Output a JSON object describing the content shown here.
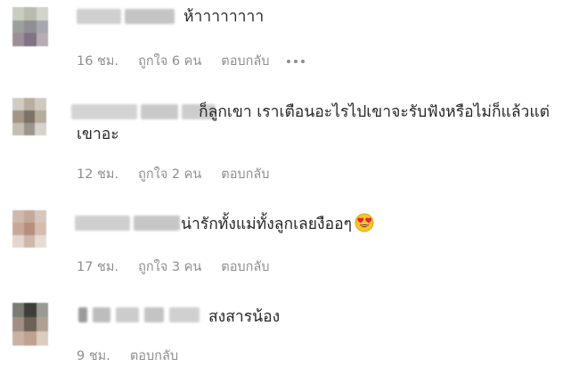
{
  "comments": [
    {
      "text_lines": [
        "ห้าาาาาาาา"
      ],
      "time": "16 ชม.",
      "likes": "ถูกใจ 6 คน",
      "reply": "ตอบกลับ",
      "has_more": true
    },
    {
      "text_lines": [
        "ก็ลูกเขา เราเตือนอะไรไปเขาจะรับฟังหรือไม่ก็แล้วแต่",
        "เขาอะ"
      ],
      "time": "12 ชม.",
      "likes": "ถูกใจ 2 คน",
      "reply": "ตอบกลับ",
      "has_more": false
    },
    {
      "text_lines": [
        "น่ารักทั้งแม่ทั้งลูกเลยงืออๆ"
      ],
      "time": "17 ชม.",
      "likes": "ถูกใจ 3 คน",
      "reply": "ตอบกลับ",
      "has_more": false,
      "emoji": "heart-eyes-emoji"
    },
    {
      "text_lines": [
        "สงสารน้อง"
      ],
      "time": "9 ชม.",
      "likes": "",
      "reply": "ตอบกลับ",
      "has_more": false
    }
  ],
  "icons": {
    "more": "more-options-icon",
    "emoji": "heart-eyes-emoji"
  },
  "colors": {
    "text": "#262626",
    "meta": "#8e8e8e"
  }
}
